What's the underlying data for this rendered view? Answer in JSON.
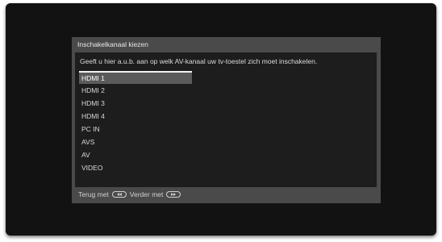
{
  "dialog": {
    "title": "Inschakelkanaal kiezen",
    "instruction": "Geeft u hier a.u.b. aan op welk AV-kanaal uw tv-toestel zich moet inschakelen.",
    "channels": [
      "HDMI 1",
      "HDMI 2",
      "HDMI 3",
      "HDMI 4",
      "PC IN",
      "AVS",
      "AV",
      "VIDEO"
    ],
    "selected_channel": "HDMI 1"
  },
  "footer": {
    "back_label": "Terug met",
    "back_icon": "rewind-button-icon",
    "next_label": "Verder met",
    "next_icon": "fast-forward-button-icon"
  },
  "colors": {
    "background": "#121212",
    "dialog": "#4a4a4a",
    "panel": "#1d1d1d",
    "highlight": "#5b5b5b"
  }
}
